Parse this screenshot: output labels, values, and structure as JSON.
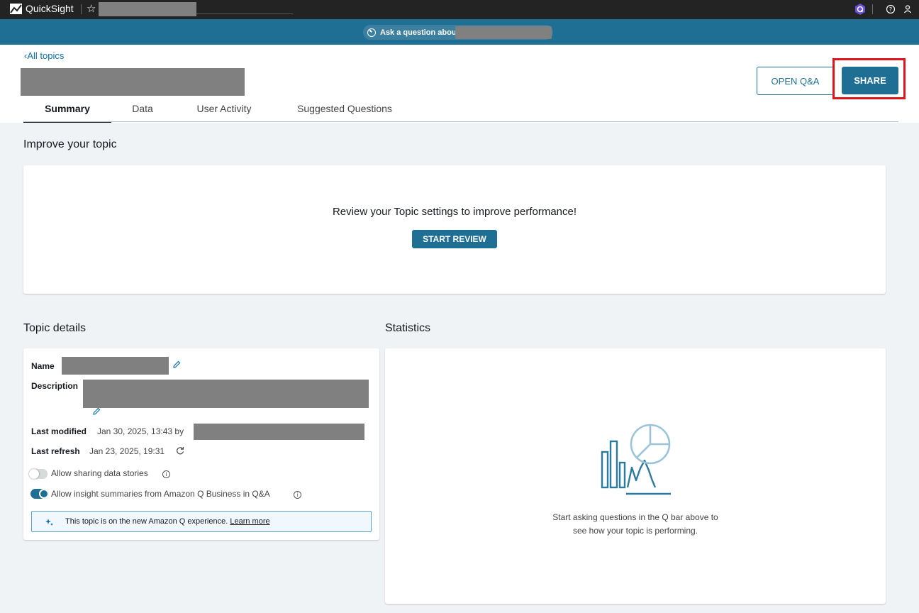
{
  "app": {
    "name": "QuickSight"
  },
  "qbar": {
    "placeholder": "Ask a question about"
  },
  "header": {
    "back_link": "All topics",
    "open_qa_label": "OPEN Q&A",
    "share_label": "SHARE",
    "tabs": [
      "Summary",
      "Data",
      "User Activity",
      "Suggested Questions"
    ],
    "active_tab": "Summary"
  },
  "improve": {
    "section_title": "Improve your topic",
    "message": "Review your Topic settings to improve performance!",
    "button_label": "START REVIEW"
  },
  "details": {
    "section_title": "Topic details",
    "name_label": "Name",
    "description_label": "Description",
    "last_modified_label": "Last modified",
    "last_modified_value": "Jan 30, 2025, 13:43 by",
    "last_refresh_label": "Last refresh",
    "last_refresh_value": "Jan 23, 2025, 19:31",
    "toggle_data_stories_label": "Allow sharing data stories",
    "toggle_data_stories_on": false,
    "toggle_insights_label": "Allow insight summaries from Amazon Q Business in Q&A",
    "toggle_insights_on": true,
    "notice_text": "This topic is on the new Amazon Q experience.",
    "notice_link": "Learn more"
  },
  "statistics": {
    "section_title": "Statistics",
    "empty_message": "Start asking questions in the Q bar above to see how your topic is performing."
  },
  "colors": {
    "primary": "#1f6f95",
    "link": "#0f6fab",
    "highlight": "#e0141b",
    "background": "#f0f3f6",
    "topbar": "#232323"
  }
}
